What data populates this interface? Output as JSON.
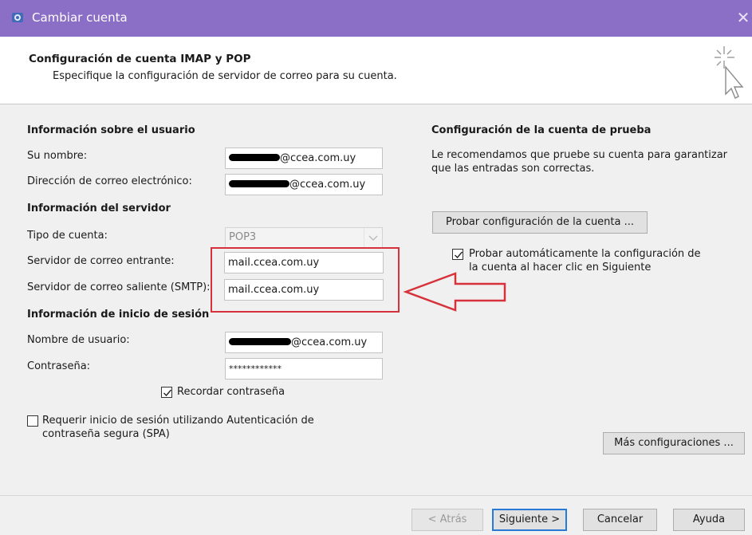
{
  "window": {
    "title": "Cambiar cuenta",
    "close_glyph": "✕"
  },
  "header": {
    "title": "Configuración de cuenta IMAP y POP",
    "subtitle": "Especifique la configuración de servidor de correo para su cuenta."
  },
  "user_info": {
    "heading": "Información sobre el usuario",
    "name_label": "Su nombre:",
    "name_value": "@ccea.com.uy",
    "email_label": "Dirección de correo electrónico:",
    "email_value": "@ccea.com.uy"
  },
  "server_info": {
    "heading": "Información del servidor",
    "account_type_label": "Tipo de cuenta:",
    "account_type_value": "POP3",
    "incoming_label": "Servidor de correo entrante:",
    "incoming_value": "mail.ccea.com.uy",
    "outgoing_label": "Servidor de correo saliente (SMTP):",
    "outgoing_value": "mail.ccea.com.uy"
  },
  "login_info": {
    "heading": "Información de inicio de sesión",
    "username_label": "Nombre de usuario:",
    "username_value": "@ccea.com.uy",
    "password_label": "Contraseña:",
    "password_value": "************",
    "remember_label": "Recordar contraseña",
    "remember_checked": true,
    "spa_label_line1": "Requerir inicio de sesión utilizando Autenticación de",
    "spa_label_line2": "contraseña segura (SPA)",
    "spa_checked": false
  },
  "test_config": {
    "heading": "Configuración de la cuenta de prueba",
    "desc_line1": "Le recomendamos que pruebe su cuenta para garantizar",
    "desc_line2": "que las entradas son correctas.",
    "test_button": "Probar configuración de la cuenta ...",
    "auto_test_line1": "Probar automáticamente la configuración de",
    "auto_test_line2": "la cuenta al hacer clic en Siguiente",
    "auto_test_checked": true,
    "more_settings_button": "Más configuraciones ..."
  },
  "footer": {
    "back": "< Atrás",
    "next": "Siguiente >",
    "cancel": "Cancelar",
    "help": "Ayuda"
  },
  "annotation": {
    "box_color": "#d7323c",
    "arrow_color": "#d7323c"
  },
  "icons": [
    "outlook-app-icon",
    "setup-wand-icon",
    "checkmark-icon",
    "dropdown-arrow-icon",
    "annotation-arrow-icon"
  ],
  "colors": {
    "titlebar": "#8b6fc7",
    "default_button_border": "#2a7ad5"
  }
}
